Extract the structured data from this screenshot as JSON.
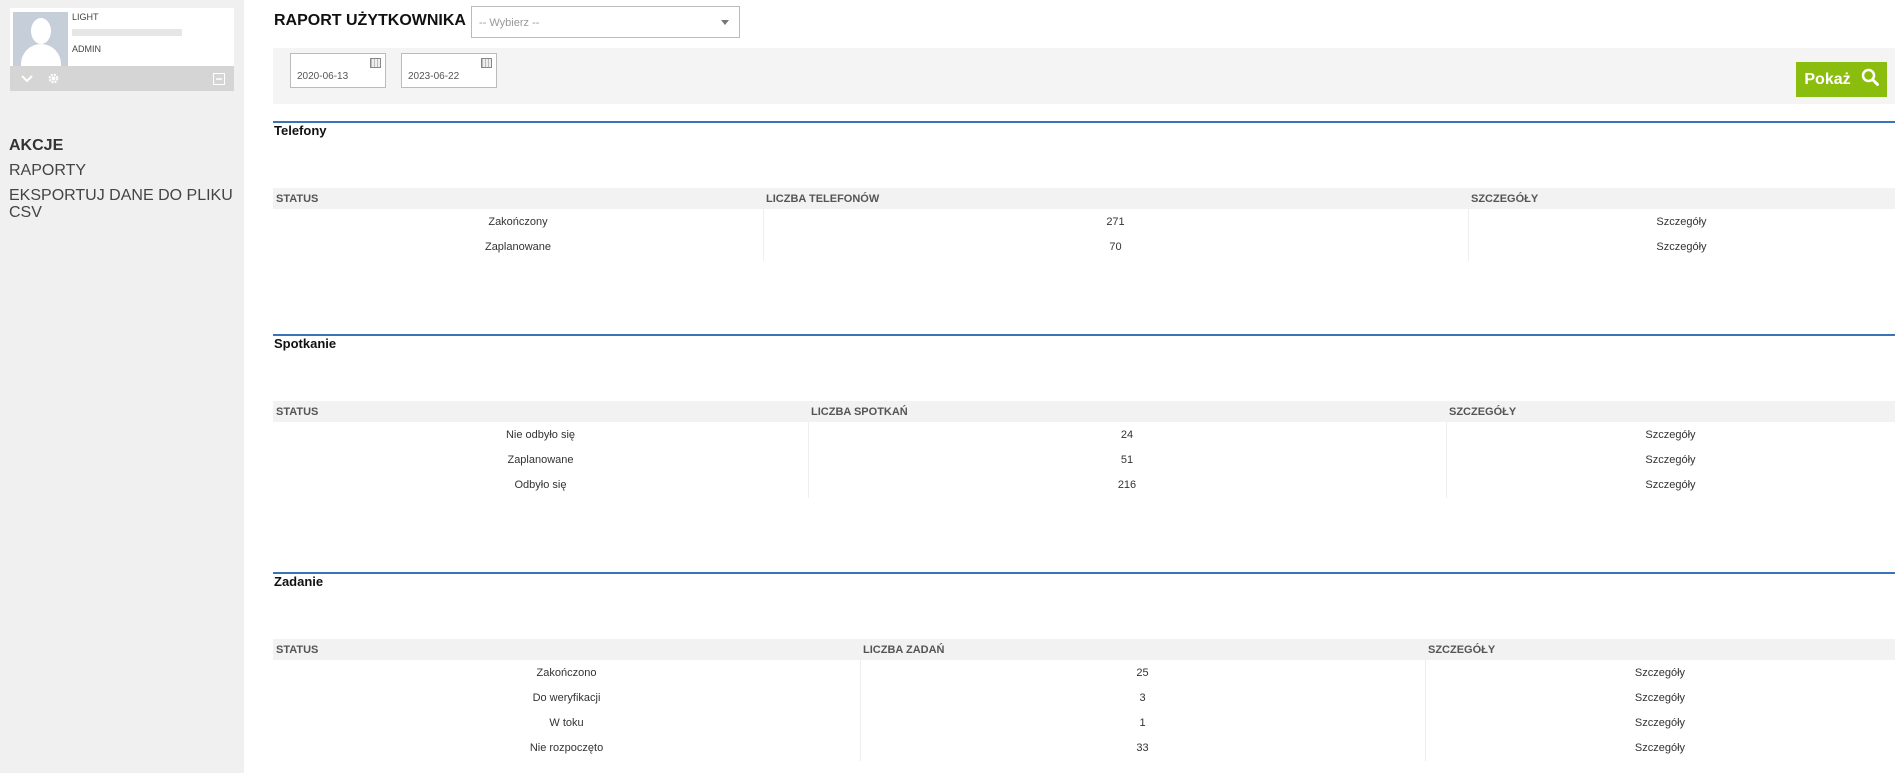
{
  "user": {
    "name": "LIGHT",
    "role": "ADMIN"
  },
  "nav": [
    {
      "label": "AKCJE"
    },
    {
      "label": "RAPORTY"
    },
    {
      "label": "EKSPORTUJ DANE DO PLIKU CSV"
    }
  ],
  "header": {
    "title": "RAPORT UŻYTKOWNIKA",
    "select_placeholder": "-- Wybierz --"
  },
  "filters": {
    "date_from": "2020-06-13",
    "date_to": "2023-06-22",
    "show_label": "Pokaż"
  },
  "telefony": {
    "title": "Telefony",
    "headers": [
      "STATUS",
      "LICZBA TELEFONÓW",
      "SZCZEGÓŁY"
    ],
    "rows": [
      {
        "status": "Zakończony",
        "count": "271",
        "details": "Szczegóły"
      },
      {
        "status": "Zaplanowane",
        "count": "70",
        "details": "Szczegóły"
      }
    ]
  },
  "spotkanie": {
    "title": "Spotkanie",
    "headers": [
      "STATUS",
      "LICZBA SPOTKAŃ",
      "SZCZEGÓŁY"
    ],
    "rows": [
      {
        "status": "Nie odbyło się",
        "count": "24",
        "details": "Szczegóły"
      },
      {
        "status": "Zaplanowane",
        "count": "51",
        "details": "Szczegóły"
      },
      {
        "status": "Odbyło się",
        "count": "216",
        "details": "Szczegóły"
      }
    ]
  },
  "zadanie": {
    "title": "Zadanie",
    "headers": [
      "STATUS",
      "LICZBA ZADAŃ",
      "SZCZEGÓŁY"
    ],
    "rows": [
      {
        "status": "Zakończono",
        "count": "25",
        "details": "Szczegóły"
      },
      {
        "status": "Do weryfikacji",
        "count": "3",
        "details": "Szczegóły"
      },
      {
        "status": "W toku",
        "count": "1",
        "details": "Szczegóły"
      },
      {
        "status": "Nie rozpoczęto",
        "count": "33",
        "details": "Szczegóły"
      }
    ]
  },
  "colors": {
    "accent_green": "#8bbd0e",
    "section_rule": "#3b73b9"
  },
  "icons": [
    "chevron-down-icon",
    "gear-icon",
    "collapse-icon",
    "calendar-icon",
    "search-icon"
  ]
}
